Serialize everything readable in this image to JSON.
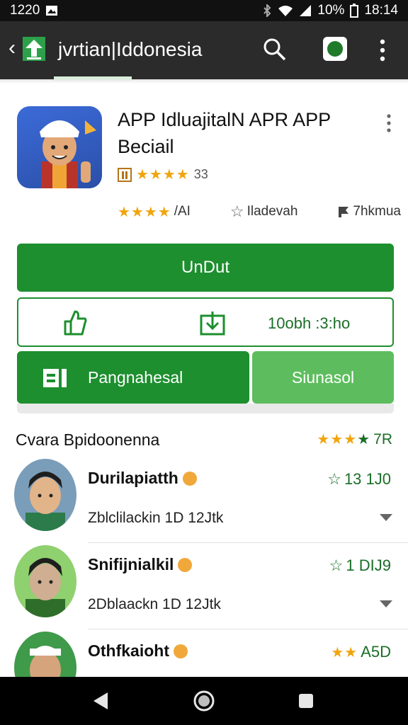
{
  "status_bar": {
    "time_left": "1220",
    "battery": "10%",
    "time_right": "18:14"
  },
  "appbar": {
    "title": "jvrtian|Iddonesia"
  },
  "app": {
    "title": "APP IdluajitalN APR APP Beciail",
    "rating_count": "33",
    "meta": {
      "rating_text": "/AI",
      "wishlist_label": "Iladevah",
      "reviews_label": "7hkmua"
    }
  },
  "buttons": {
    "download": "UnDut",
    "size_text": "10obh :3:ho",
    "install": "Pangnahesal",
    "share": "Siunasol"
  },
  "reviews_section": {
    "title": "Cvara Bpidoonenna",
    "rating": "7R",
    "items": [
      {
        "name": "Durilapiatth",
        "score": "13 1J0",
        "date": "Zblclilackin 1D 12Jtk"
      },
      {
        "name": "Snifijnialkil",
        "score": "1 DIJ9",
        "date": "2Dblaackn 1D 12Jtk"
      },
      {
        "name": "Othfkaioht",
        "score": "A5D",
        "date": ""
      }
    ]
  },
  "colors": {
    "primary": "#1d8f2e",
    "secondary": "#5dbd5e",
    "star": "#f0a50d",
    "appbar": "#2b2b2b"
  },
  "icons": [
    "back-arrow-icon",
    "store-logo-icon",
    "search-icon",
    "account-icon",
    "more-icon",
    "like-icon",
    "dislike-icon",
    "install-icon",
    "verified-icon",
    "chevron-down-icon",
    "nav-back-icon",
    "nav-home-icon",
    "nav-recent-icon"
  ]
}
